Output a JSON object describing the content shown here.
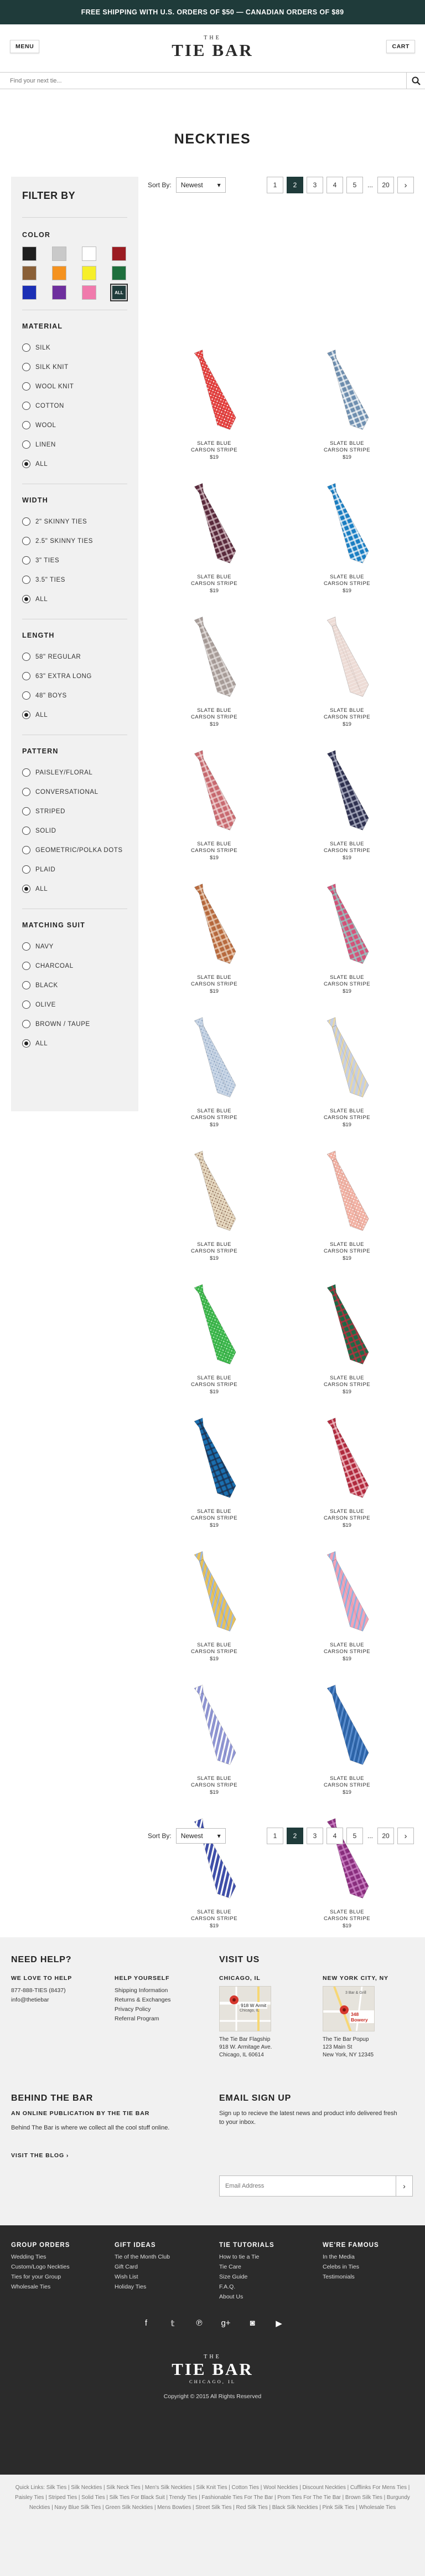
{
  "banner": {
    "text": "FREE SHIPPING WITH U.S. ORDERS OF $50 — CANADIAN ORDERS OF $89"
  },
  "header": {
    "menu_label": "MENU",
    "cart_label": "CART",
    "logo_the": "THE",
    "logo_name": "TIE BAR"
  },
  "search": {
    "placeholder": "Find your next tie..."
  },
  "page": {
    "title": "NECKTIES"
  },
  "filters": {
    "title": "FILTER BY",
    "color": {
      "heading": "COLOR",
      "selected_label": "ALL",
      "swatches": [
        "#1f1f1f",
        "#c9c9c9",
        "#ffffff",
        "#9b1c22",
        "#8a6038",
        "#f5921f",
        "#f6ef2a",
        "#1e6f3d",
        "#1b2fb5",
        "#6e2f9e",
        "#f07aac",
        "#1f3b3a"
      ]
    },
    "material": {
      "heading": "MATERIAL",
      "options": [
        "SILK",
        "SILK KNIT",
        "WOOL KNIT",
        "COTTON",
        "WOOL",
        "LINEN",
        "ALL"
      ],
      "selected": 6
    },
    "width": {
      "heading": "WIDTH",
      "options": [
        "2\" SKINNY TIES",
        "2.5\" SKINNY TIES",
        "3\" TIES",
        "3.5\" TIES",
        "ALL"
      ],
      "selected": 4
    },
    "length": {
      "heading": "LENGTH",
      "options": [
        "58\" REGULAR",
        "63\" EXTRA LONG",
        "48\" BOYS",
        "ALL"
      ],
      "selected": 3
    },
    "pattern": {
      "heading": "PATTERN",
      "options": [
        "PAISLEY/FLORAL",
        "CONVERSATIONAL",
        "STRIPED",
        "SOLID",
        "GEOMETRIC/POLKA DOTS",
        "PLAID",
        "ALL"
      ],
      "selected": 6
    },
    "matching_suit": {
      "heading": "MATCHING SUIT",
      "options": [
        "NAVY",
        "CHARCOAL",
        "BLACK",
        "OLIVE",
        "BROWN / TAUPE",
        "ALL"
      ],
      "selected": 5
    }
  },
  "sort": {
    "label": "Sort By:",
    "value": "Newest"
  },
  "pagination": {
    "pages": [
      "1",
      "2",
      "3",
      "4",
      "5",
      "...",
      "20"
    ],
    "current": "2",
    "next_icon": "chevron-right-icon"
  },
  "products": [
    {
      "line1": "SLATE BLUE",
      "line2": "CARSON STRIPE",
      "price": "$19",
      "color": "#e3413f",
      "accent": "#ffffff",
      "pattern": "dots"
    },
    {
      "line1": "SLATE BLUE",
      "line2": "CARSON STRIPE",
      "price": "$19",
      "color": "#6f8fb0",
      "accent": "#ffffff",
      "pattern": "check"
    },
    {
      "line1": "SLATE BLUE",
      "line2": "CARSON STRIPE",
      "price": "$19",
      "color": "#5a2a3c",
      "accent": "#d9c2c8",
      "pattern": "check"
    },
    {
      "line1": "SLATE BLUE",
      "line2": "CARSON STRIPE",
      "price": "$19",
      "color": "#1a7fc4",
      "accent": "#ffffff",
      "pattern": "check"
    },
    {
      "line1": "SLATE BLUE",
      "line2": "CARSON STRIPE",
      "price": "$19",
      "color": "#a79c98",
      "accent": "#e9e4e2",
      "pattern": "check"
    },
    {
      "line1": "SLATE BLUE",
      "line2": "CARSON STRIPE",
      "price": "$19",
      "color": "#eddcd6",
      "accent": "#ffffff",
      "pattern": "solid"
    },
    {
      "line1": "SLATE BLUE",
      "line2": "CARSON STRIPE",
      "price": "$19",
      "color": "#c96a70",
      "accent": "#f3dadb",
      "pattern": "check"
    },
    {
      "line1": "SLATE BLUE",
      "line2": "CARSON STRIPE",
      "price": "$19",
      "color": "#2f3150",
      "accent": "#b9bccf",
      "pattern": "check"
    },
    {
      "line1": "SLATE BLUE",
      "line2": "CARSON STRIPE",
      "price": "$19",
      "color": "#b86a3e",
      "accent": "#f0d8c3",
      "pattern": "check"
    },
    {
      "line1": "SLATE BLUE",
      "line2": "CARSON STRIPE",
      "price": "$19",
      "color": "#d6537a",
      "accent": "#8fd1c9",
      "pattern": "check"
    },
    {
      "line1": "SLATE BLUE",
      "line2": "CARSON STRIPE",
      "price": "$19",
      "color": "#c9d6e6",
      "accent": "#8ea6c4",
      "pattern": "dots"
    },
    {
      "line1": "SLATE BLUE",
      "line2": "CARSON STRIPE",
      "price": "$19",
      "color": "#c6cfe3",
      "accent": "#e8d7a6",
      "pattern": "stripe"
    },
    {
      "line1": "SLATE BLUE",
      "line2": "CARSON STRIPE",
      "price": "$19",
      "color": "#e6d8c0",
      "accent": "#8c6a55",
      "pattern": "dots"
    },
    {
      "line1": "SLATE BLUE",
      "line2": "CARSON STRIPE",
      "price": "$19",
      "color": "#f0b0a2",
      "accent": "#ffffff",
      "pattern": "dots"
    },
    {
      "line1": "SLATE BLUE",
      "line2": "CARSON STRIPE",
      "price": "$19",
      "color": "#3bb54a",
      "accent": "#bdf0c3",
      "pattern": "dots"
    },
    {
      "line1": "SLATE BLUE",
      "line2": "CARSON STRIPE",
      "price": "$19",
      "color": "#1d6b47",
      "accent": "#c9283d",
      "pattern": "check"
    },
    {
      "line1": "SLATE BLUE",
      "line2": "CARSON STRIPE",
      "price": "$19",
      "color": "#1a6fb0",
      "accent": "#1c2d4a",
      "pattern": "check"
    },
    {
      "line1": "SLATE BLUE",
      "line2": "CARSON STRIPE",
      "price": "$19",
      "color": "#b22a3e",
      "accent": "#f5c8cf",
      "pattern": "check"
    },
    {
      "line1": "SLATE BLUE",
      "line2": "CARSON STRIPE",
      "price": "$19",
      "color": "#e8c25a",
      "accent": "#9cb8e0",
      "pattern": "stripe"
    },
    {
      "line1": "SLATE BLUE",
      "line2": "CARSON STRIPE",
      "price": "$19",
      "color": "#f3a3b6",
      "accent": "#8fb3e3",
      "pattern": "stripe"
    },
    {
      "line1": "SLATE BLUE",
      "line2": "CARSON STRIPE",
      "price": "$19",
      "color": "#8f95d3",
      "accent": "#ffffff",
      "pattern": "stripe"
    },
    {
      "line1": "SLATE BLUE",
      "line2": "CARSON STRIPE",
      "price": "$19",
      "color": "#2d64a8",
      "accent": "#5b8fd0",
      "pattern": "stripe"
    },
    {
      "line1": "SLATE BLUE",
      "line2": "CARSON STRIPE",
      "price": "$19",
      "color": "#3f4faa",
      "accent": "#ffffff",
      "pattern": "stripe"
    },
    {
      "line1": "SLATE BLUE",
      "line2": "CARSON STRIPE",
      "price": "$19",
      "color": "#8a2e7e",
      "accent": "#d38bcc",
      "pattern": "check"
    }
  ],
  "footer": {
    "need_help": {
      "title": "NEED HELP?"
    },
    "love_to_help": {
      "heading": "WE LOVE TO HELP",
      "phone": "877-888-TIES (8437)",
      "email": "info@thetiebar"
    },
    "help_yourself": {
      "heading": "HELP YOURSELF",
      "links": [
        "Shipping Information",
        "Returns & Exchanges",
        "Privacy Policy",
        "Referral Program"
      ]
    },
    "visit": {
      "title": "VISIT US",
      "chicago": {
        "heading": "CHICAGO, IL",
        "map_label": "918 W Armit",
        "map_sub": "Chicago, IL",
        "name": "The Tie Bar Flagship",
        "addr1": "918 W. Armitage Ave.",
        "addr2": "Chicago, IL 60614"
      },
      "newyork": {
        "heading": "NEW YORK CITY, NY",
        "map_label": "348 Bowery",
        "map_top": "3 Bar & Grill",
        "name": "The Tie Bar Popup",
        "addr1": "123 Main St",
        "addr2": "New York, NY 12345"
      }
    },
    "behind": {
      "title": "BEHIND THE BAR",
      "subtitle": "AN ONLINE PUBLICATION BY THE TIE BAR",
      "body": "Behind The Bar is where we collect all the cool stuff online.",
      "link": "VISIT THE BLOG ›"
    },
    "signup": {
      "title": "EMAIL SIGN UP",
      "body": "Sign up to recieve the latest news and product info delivered fresh to your inbox.",
      "placeholder": "Email Address"
    },
    "dark": {
      "groups": {
        "heading": "GROUP ORDERS",
        "links": [
          "Wedding Ties",
          "Custom/Logo Neckties",
          "Ties for your Group",
          "Wholesale Ties"
        ]
      },
      "gifts": {
        "heading": "GIFT IDEAS",
        "links": [
          "Tie of the Month Club",
          "Gift Card",
          "Wish List",
          "Holiday Ties"
        ]
      },
      "tutorials": {
        "heading": "TIE TUTORIALS",
        "links": [
          "How to tie a Tie",
          "Tie Care",
          "Size Guide",
          "F.A.Q.",
          "About Us"
        ]
      },
      "famous": {
        "heading": "WE'RE FAMOUS",
        "links": [
          "In the Media",
          "Celebs in Ties",
          "Testimonials"
        ]
      },
      "social": [
        "f",
        "t",
        "p",
        "g+",
        "ig",
        "yt"
      ],
      "logo_the": "THE",
      "logo_name": "TIE BAR",
      "logo_city": "CHICAGO, IL",
      "copyright": "Copyright © 2015 All Rights Reserved"
    },
    "quick_links": "Quick Links: Silk Ties | Silk Neckties | Silk Neck Ties | Men's Silk Neckties | Silk Knit Ties | Cotton Ties | Wool Neckties | Discount Neckties | Cufflinks For Mens Ties | Paisley Ties | Striped Ties | Solid Ties | Silk Ties For Black Suit | Trendy Ties | Fashionable Ties For The Bar | Prom Ties For The Tie Bar | Brown Silk Ties | Burgundy Neckties | Navy Blue Silk Ties | Green Silk Neckties | Mens Bowties | Street Silk Ties | Red Silk Ties | Black Silk Neckties | Pink Silk Ties | Wholesale Ties"
  }
}
